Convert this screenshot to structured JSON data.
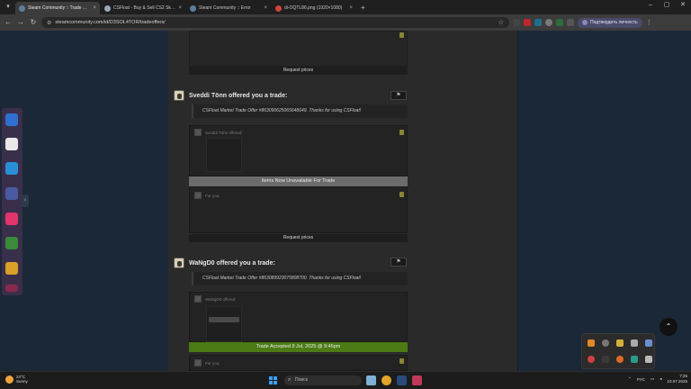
{
  "browser": {
    "tabs": [
      {
        "title": "Steam Community :: Trade Offers",
        "active": true,
        "favicon_color": "#5c7e9a"
      },
      {
        "title": "CSFloat - Buy & Sell CS2 Skins",
        "active": false,
        "favicon_color": "#9fa9b6"
      },
      {
        "title": "Steam Community :: Error",
        "active": false,
        "favicon_color": "#5c7e9a"
      },
      {
        "title": "di-OQTL86.png (1920×1080)",
        "active": false,
        "favicon_color": "#d0453a"
      }
    ],
    "url": "steamcommunity.com/id/D3SOL4TOR/tradeoffers/",
    "profile_label": "Подтвердить личность",
    "new_tab": "+",
    "close_glyph": "×"
  },
  "offers": [
    {
      "request_label": "Request prices"
    },
    {
      "title": "Sveddi Tönn offered you a trade:",
      "message": "CSFloat Market Trade Offer #863090625065648649. Thanks for using CSFloat!",
      "their_label": "Sveddi Tönn offered:",
      "status": "Items Now Unavailable For Trade",
      "for_you_label": "For you:",
      "request_label": "Request prices"
    },
    {
      "title": "WaNgD0 offered you a trade:",
      "message": "CSFloat Market Trade Offer #863089923075808700. Thanks for using CSFloat!",
      "their_label": "WaNgD0 offered:",
      "status": "Trade Accepted 9 Jul, 2025 @ 9:45pm",
      "for_you_label": "For you:"
    }
  ],
  "taskbar": {
    "weather_temp": "24°C",
    "weather_desc": "Sunny",
    "search_placeholder": "Поиск",
    "lang": "РУС",
    "time": "7:25",
    "date": "10.07.2025"
  }
}
